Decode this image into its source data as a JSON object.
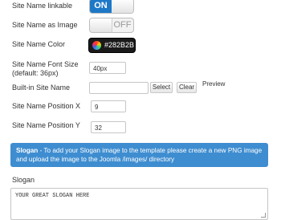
{
  "fields": {
    "site_name_linkable": {
      "label": "Site Name linkable",
      "toggle": "ON"
    },
    "site_name_as_image": {
      "label": "Site Name as Image",
      "toggle": "OFF"
    },
    "site_name_color": {
      "label": "Site Name Color",
      "value": "#282B2B"
    },
    "site_name_font_size": {
      "label_line1": "Site Name Font Size",
      "label_line2": "(default: 36px)",
      "value": "40px"
    },
    "builtin_site_name": {
      "label": "Built-in Site Name",
      "value": "",
      "select_label": "Select",
      "clear_label": "Clear",
      "preview_label": "Preview"
    },
    "site_name_position_x": {
      "label": "Site Name Position X",
      "value": "9"
    },
    "site_name_position_y": {
      "label": "Site Name Position Y",
      "value": "32"
    }
  },
  "info": {
    "title": "Slogan",
    "text": " - To add your Slogan image to the template please create a new PNG image and upload the image to the Joomla /images/ directory"
  },
  "slogan": {
    "label": "Slogan",
    "value": "YOUR GREAT SLOGAN HERE"
  },
  "colors": {
    "accent": "#1e78c8",
    "info_bg": "#3e8dd0",
    "color_value": "#282B2B"
  }
}
